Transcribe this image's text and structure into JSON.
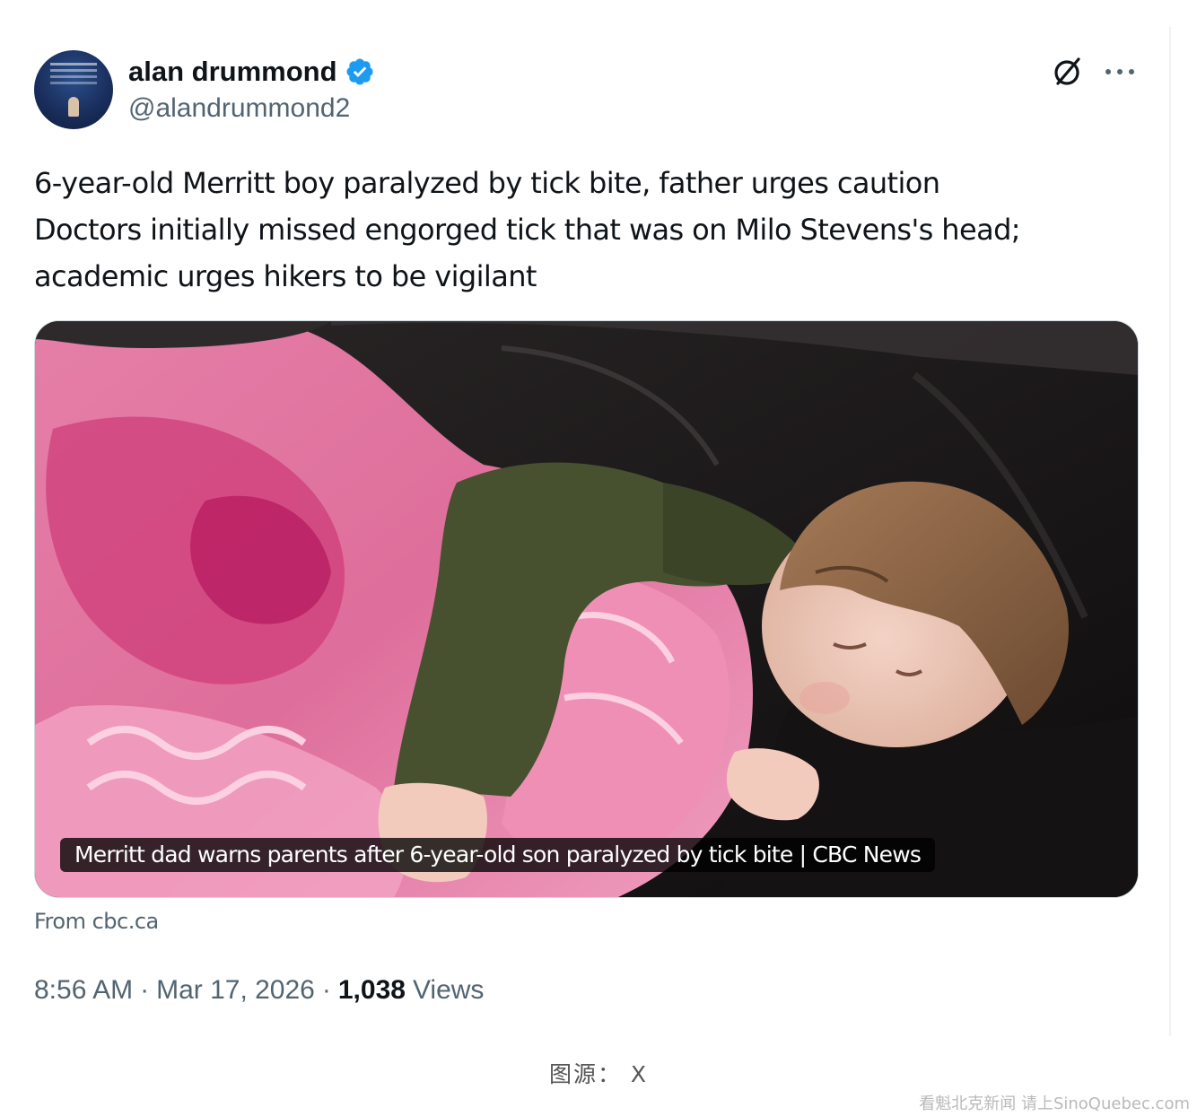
{
  "author": {
    "display_name": "alan drummond",
    "handle": "@alandrummond2"
  },
  "tweet": {
    "lines": [
      "6-year-old Merritt boy paralyzed by tick bite, father urges caution",
      "Doctors initially missed engorged tick that was on Milo Stevens's head;",
      "academic urges hikers to be vigilant"
    ]
  },
  "card": {
    "caption": "Merritt dad warns parents after 6-year-old son paralyzed by tick bite | CBC News",
    "source": "From cbc.ca"
  },
  "meta": {
    "time": "8:56 AM",
    "date": "Mar 17, 2026",
    "separator": "·",
    "views_count": "1,038",
    "views_label": "Views"
  },
  "page": {
    "credit": "图源： X",
    "watermark": "看魁北克新闻 请上SinoQuebec.com"
  },
  "icons": {
    "verified": "verified-badge-icon",
    "grok": "grok-icon",
    "more": "more-options-icon"
  },
  "colors": {
    "text_primary": "#0f1419",
    "text_secondary": "#536471",
    "verified_blue": "#1d9bf0"
  }
}
